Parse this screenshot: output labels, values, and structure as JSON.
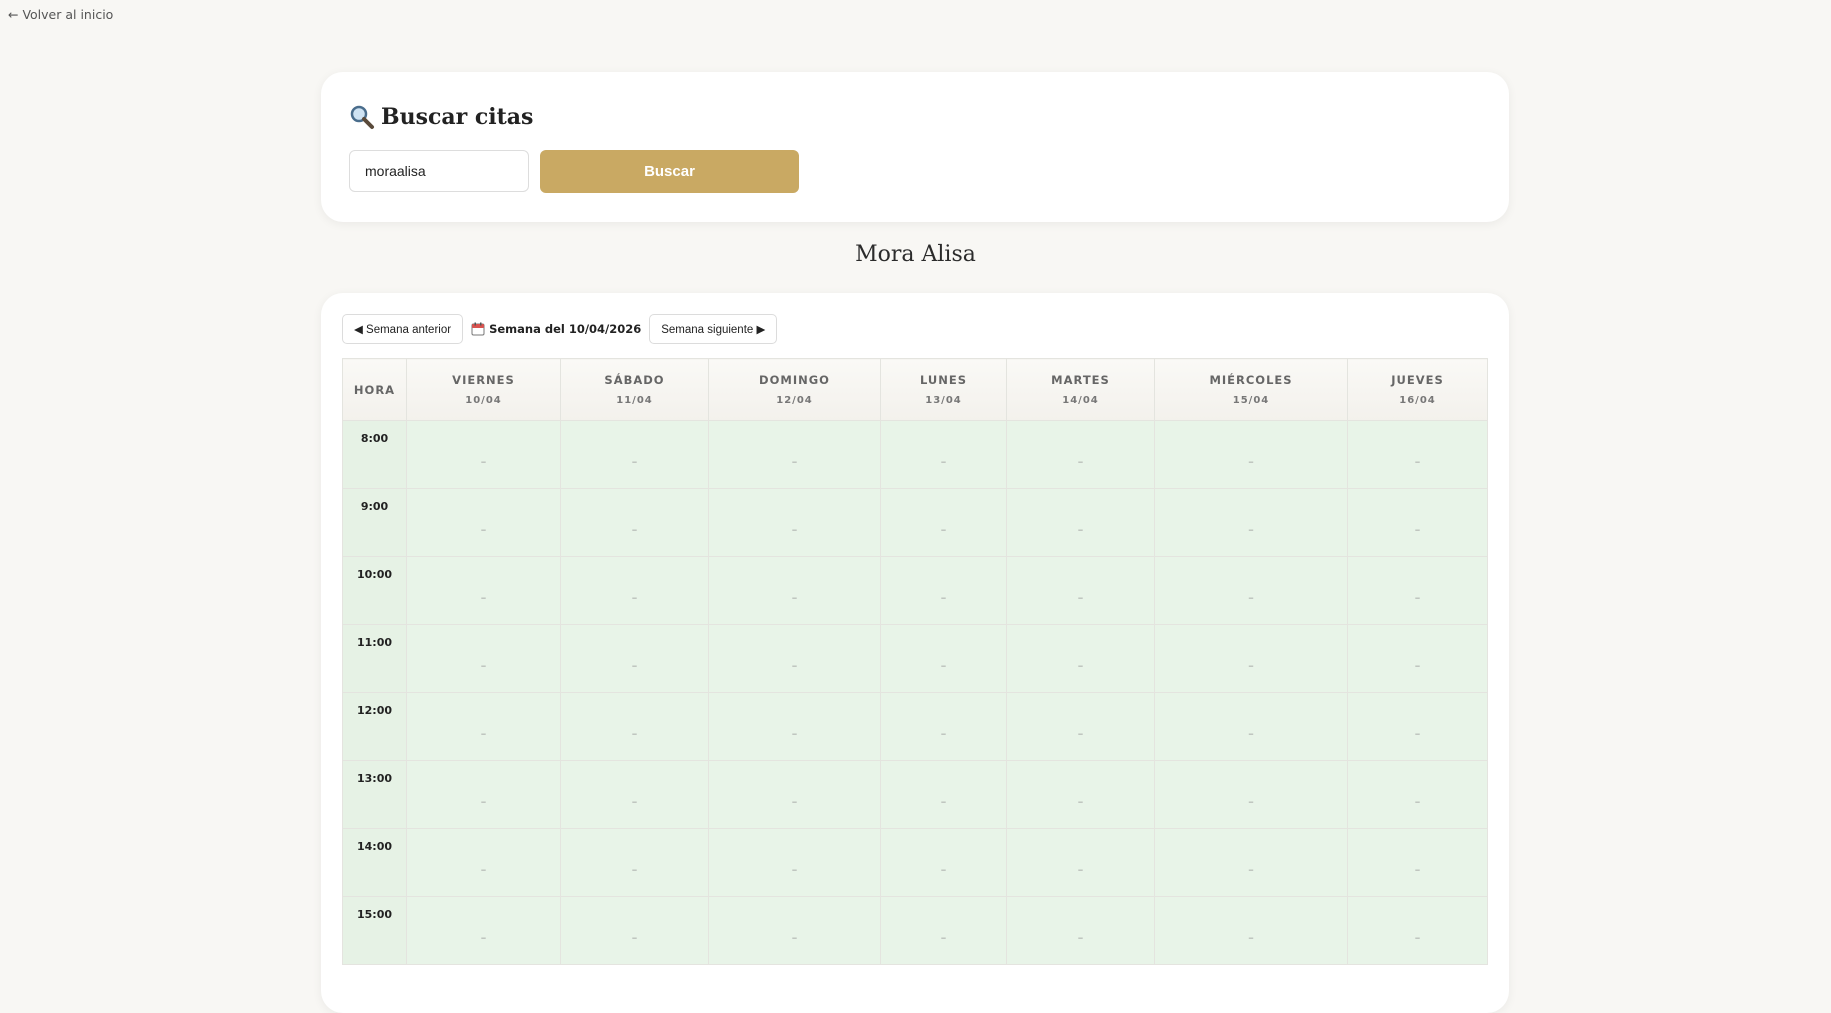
{
  "nav": {
    "back_label": "← Volver al inicio"
  },
  "search": {
    "title": "Buscar citas",
    "icon": "magnifier-icon",
    "input_value": "moraalisa",
    "button_label": "Buscar"
  },
  "person": {
    "name": "Mora Alisa"
  },
  "week": {
    "prev_label": "◀ Semana anterior",
    "current_label": "Semana del 10/04/2026",
    "next_label": "Semana siguiente ▶"
  },
  "calendar": {
    "hour_header": "HORA",
    "days": [
      {
        "name": "VIERNES",
        "date": "10/04"
      },
      {
        "name": "SÁBADO",
        "date": "11/04"
      },
      {
        "name": "DOMINGO",
        "date": "12/04"
      },
      {
        "name": "LUNES",
        "date": "13/04"
      },
      {
        "name": "MARTES",
        "date": "14/04"
      },
      {
        "name": "MIÉRCOLES",
        "date": "15/04"
      },
      {
        "name": "JUEVES",
        "date": "16/04"
      }
    ],
    "hours": [
      "8:00",
      "9:00",
      "10:00",
      "11:00",
      "12:00",
      "13:00",
      "14:00",
      "15:00"
    ],
    "empty_slot": "–",
    "free_color": "#e8f4e8"
  },
  "colors": {
    "accent": "#c9a963",
    "background": "#f8f7f4"
  }
}
